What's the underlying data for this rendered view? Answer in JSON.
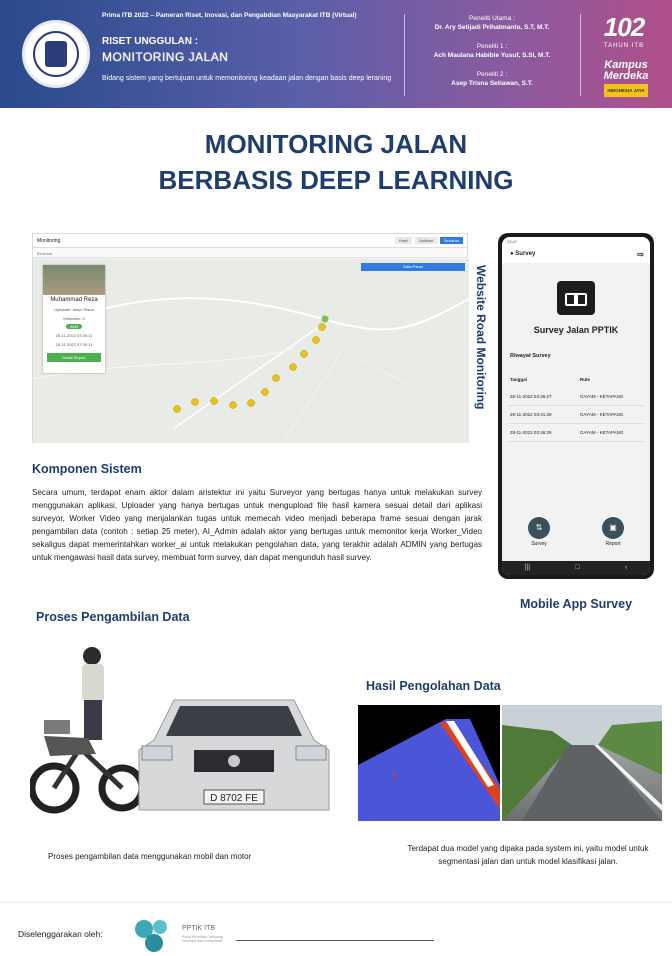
{
  "header": {
    "event": "Prima ITB 2022 – Pameran Riset, Inovasi, dan Pengabdian Masyarakat ITB (Virtual)",
    "riset_label": "RISET UNGGULAN :",
    "riset_title": "MONITORING JALAN",
    "description": "Bidang sistem yang bertujuan untuk memonitoring keadaan jalan dengan basis deep leraning",
    "researchers": [
      {
        "role": "Peneliti Utama :",
        "name": "Dr. Ary Setijadi Prihatmanto, S.T, M.T."
      },
      {
        "role": "Peneliti 1 :",
        "name": "Ach Maulana Habibie Yusuf, S.SI, M.T."
      },
      {
        "role": "Peneliti 2 :",
        "name": "Asep Trisna Setiawan, S.T."
      }
    ],
    "anniversary_number": "102",
    "anniversary_text": "TAHUN ITB",
    "kampus": "Kampus Merdeka",
    "kampus_tag": "INDONESIA JAYA",
    "brand_color": "#2a4a8c"
  },
  "title": {
    "line1": "MONITORING JALAN",
    "line2": "BERBASIS DEEP LEARNING"
  },
  "web": {
    "label": "Website Road Monitoring",
    "app_title": "Monitoring",
    "sub": "Beranda",
    "tabs": [
      "Hasil",
      "Aplikasi",
      "Sebaran"
    ],
    "data_panel": "Data Panel",
    "profile": {
      "name": "Muhammad Reza",
      "l1": "Uploader: Asep Trisna",
      "l2": "Kilometer: 0",
      "pill": "Aktif",
      "d1": "20-11-2022 07:30:11",
      "d2": "20-11-2022 07:30:11",
      "btn": "Detail Report"
    }
  },
  "mobile": {
    "label": "Mobile App Survey",
    "status_time": "13:47",
    "appbar": "Survey",
    "title": "Survey Jalan PPTIK",
    "riwayat": "Riwayat Survey",
    "col_date": "Tanggal",
    "col_route": "Rute",
    "rows": [
      {
        "date": "28-11-2022 03:36:27",
        "route": "GAYAM - KETAPANG"
      },
      {
        "date": "28-11-2022 03:41:29",
        "route": "GAYAM - KETAPANG"
      },
      {
        "date": "28-11-2022 03:46:29",
        "route": "GAYAM - KETAPANG"
      }
    ],
    "btn_survey": "Survey",
    "btn_report": "Report"
  },
  "komponen": {
    "heading": "Komponen Sistem",
    "text": "Secara umum, terdapat enam aktor dalam aristektur ini yaitu Surveyor yang bertugas hanya untuk melakukan survey menggunakan aplikasi, Uploader yang hanya bertugas untuk mengupload file hasil kamera sesuai detail dari aplikasi surveyor, Worker Video yang menjalankan tugas untuk memecah video menjadi beberapa frame sesuai dengan jarak pengambilan data (contoh : setiap 25 meter), AI_Admin adalah aktor yang bertugas untuk memonitor kerja Worker_Video sekaligus dapat memerintahkan worker_ai untuk melakukan pengolahan data, yang terakhir adalah ADMIN yang bertugas untuk mengawasi hasil data survey, membuat form survey, dan dapat mengunduh hasil survey."
  },
  "proses": {
    "heading": "Proses Pengambilan Data",
    "caption": "Proses pengambilan data menggunakan mobil dan motor",
    "plate": "D 8702 FE"
  },
  "hasil": {
    "heading": "Hasil Pengolahan Data",
    "caption": "Terdapat dua model yang dipaka pada system ini, yaitu model untuk segmentasi jalan dan untuk model klasifikasi jalan."
  },
  "footer": {
    "by": "Diselenggarakan oleh:",
    "org": "PPTIK ITB",
    "org_sub": "Pusat Penelitian Teknologi Informasi dan Komunikasi"
  }
}
